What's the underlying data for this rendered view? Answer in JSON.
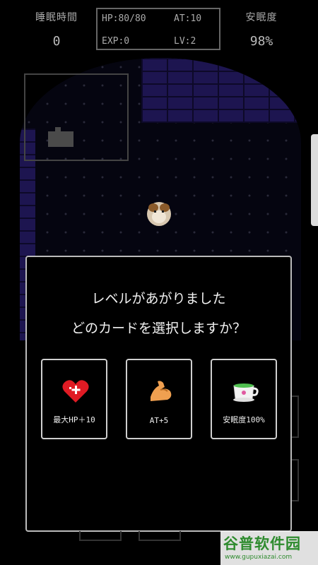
{
  "hud": {
    "sleep_time_label": "睡眠時間",
    "sleep_time_value": "0",
    "hp": "HP:80/80",
    "at": "AT:10",
    "exp": "EXP:0",
    "lv": "LV:2",
    "sleep_quality_label": "安眠度",
    "sleep_quality_value": "98%"
  },
  "dialog": {
    "line1": "レベルがあがりました",
    "line2": "どのカードを選択しますか？",
    "cards": [
      {
        "icon": "heart-plus-icon",
        "label": "最大HP＋10"
      },
      {
        "icon": "flexed-arm-icon",
        "label": "AT+5"
      },
      {
        "icon": "teacup-icon",
        "label": "安眠度100%"
      }
    ]
  },
  "watermark": {
    "name": "谷普软件园",
    "url": "www.gupuxiazai.com"
  },
  "colors": {
    "wall": "#1d1550",
    "dialog_border": "#bbbbbb",
    "watermark": "#2e8b2e"
  }
}
